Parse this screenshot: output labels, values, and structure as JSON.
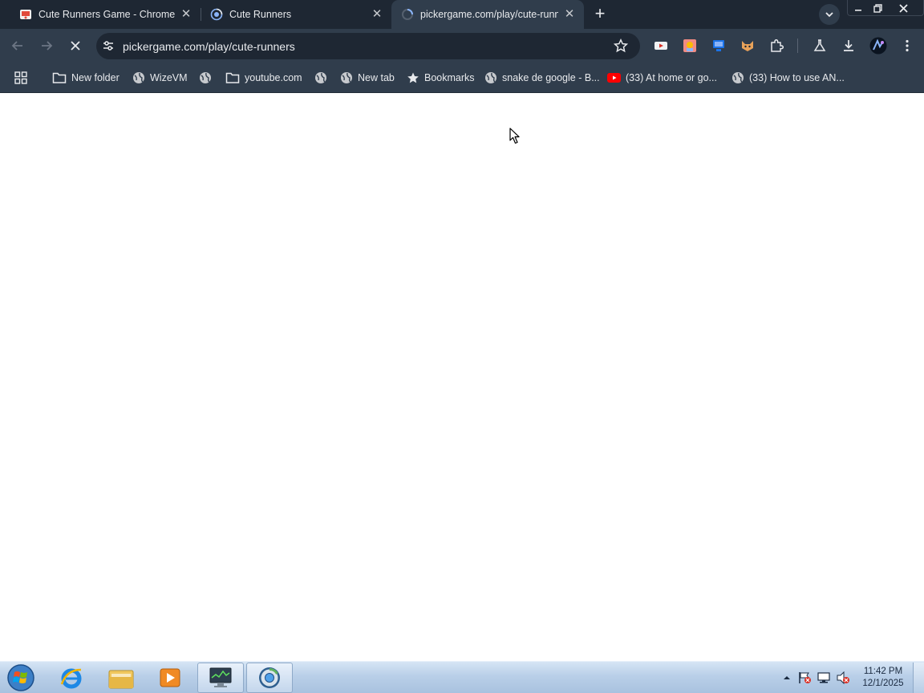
{
  "browser": {
    "tabs": [
      {
        "title": "Cute Runners Game - Chrome Web Store",
        "icon": "game-favicon",
        "active": false
      },
      {
        "title": "Cute Runners",
        "icon": "loading-globe-favicon",
        "active": false
      },
      {
        "title": "pickergame.com/play/cute-runners",
        "icon": "loading-spinner-favicon",
        "active": true
      }
    ],
    "new_tab_symbol": "+",
    "close_symbol": "✕",
    "address_bar": {
      "url": "pickergame.com/play/cute-runners"
    },
    "bookmarks": [
      {
        "label": "",
        "icon": "apps-grid-icon"
      },
      {
        "label": "New folder",
        "icon": "folder-icon"
      },
      {
        "label": "WizeVM",
        "icon": "globe-icon"
      },
      {
        "label": "",
        "icon": "globe-icon"
      },
      {
        "label": "youtube.com",
        "icon": "folder-icon"
      },
      {
        "label": "",
        "icon": "globe-icon"
      },
      {
        "label": "New tab",
        "icon": "globe-icon"
      },
      {
        "label": "Bookmarks",
        "icon": "star-icon"
      },
      {
        "label": "snake de google - B...",
        "icon": "globe-icon"
      },
      {
        "label": "(33) At home or go...",
        "icon": "youtube-icon"
      },
      {
        "label": "(33) How to use AN...",
        "icon": "globe-icon"
      }
    ]
  },
  "taskbar": {
    "clock_time": "11:42 PM",
    "clock_date": "12/1/2025"
  },
  "colors": {
    "tabstrip": "#1e2733",
    "toolbar": "#303d4c",
    "page": "#ffffff"
  }
}
